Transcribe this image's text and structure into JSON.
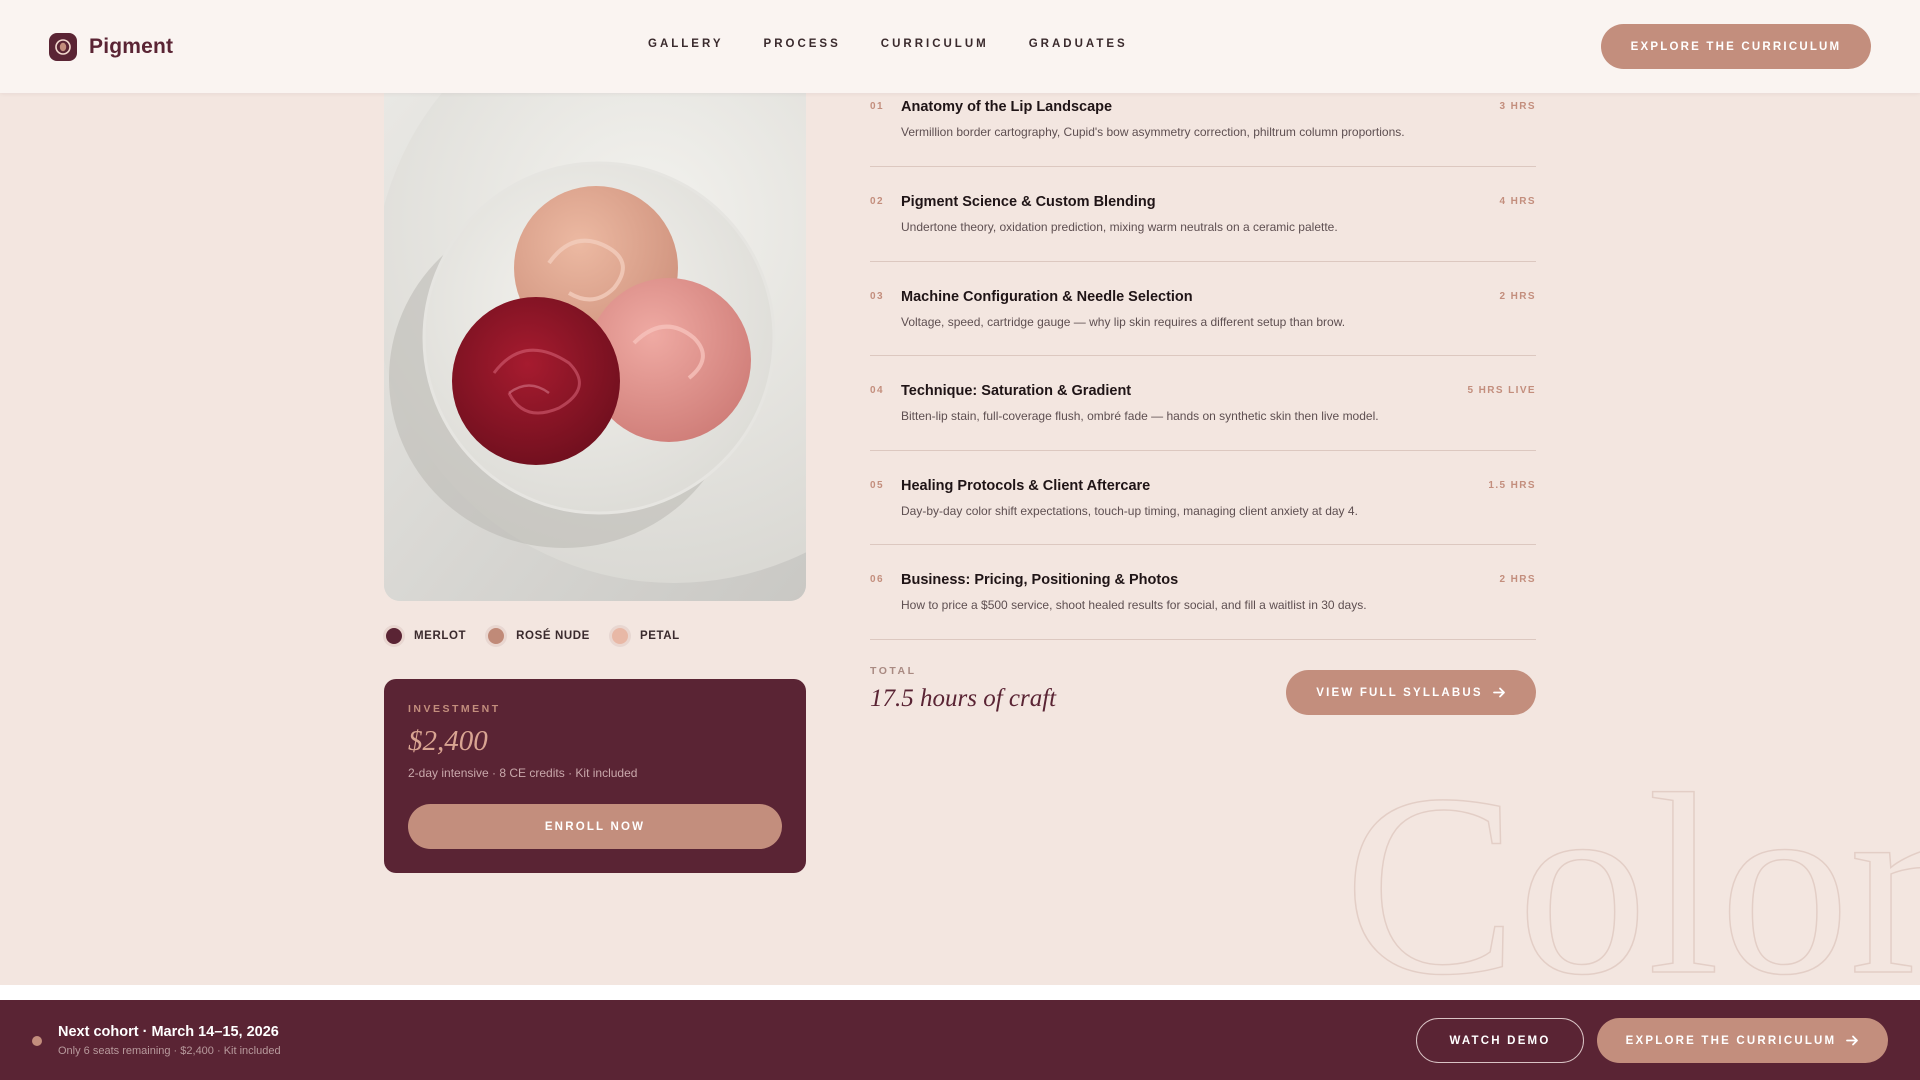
{
  "brand": {
    "name": "Pigment",
    "icon": "lip-logo-icon"
  },
  "nav": [
    {
      "label": "GALLERY"
    },
    {
      "label": "PROCESS"
    },
    {
      "label": "CURRICULUM"
    },
    {
      "label": "GRADUATES"
    }
  ],
  "header": {
    "cta_label": "EXPLORE THE CURRICULUM"
  },
  "swatches": [
    {
      "label": "MERLOT",
      "color": "#5a2434"
    },
    {
      "label": "ROSÉ NUDE",
      "color": "#c08a78"
    },
    {
      "label": "PETAL",
      "color": "#e8b8a6"
    }
  ],
  "investment": {
    "label": "INVESTMENT",
    "price": "$2,400",
    "meta": "2-day intensive · 8 CE credits · Kit included",
    "enroll_label": "ENROLL NOW"
  },
  "modules": [
    {
      "num": "01",
      "title": "Anatomy of the Lip Landscape",
      "desc": "Vermillion border cartography, Cupid's bow asymmetry correction, philtrum column proportions.",
      "hours": "3 HRS"
    },
    {
      "num": "02",
      "title": "Pigment Science & Custom Blending",
      "desc": "Undertone theory, oxidation prediction, mixing warm neutrals on a ceramic palette.",
      "hours": "4 HRS"
    },
    {
      "num": "03",
      "title": "Machine Configuration & Needle Selection",
      "desc": "Voltage, speed, cartridge gauge — why lip skin requires a different setup than brow.",
      "hours": "2 HRS"
    },
    {
      "num": "04",
      "title": "Technique: Saturation & Gradient",
      "desc": "Bitten-lip stain, full-coverage flush, ombré fade — hands on synthetic skin then live model.",
      "hours": "5 HRS LIVE"
    },
    {
      "num": "05",
      "title": "Healing Protocols & Client Aftercare",
      "desc": "Day-by-day color shift expectations, touch-up timing, managing client anxiety at day 4.",
      "hours": "1.5 HRS"
    },
    {
      "num": "06",
      "title": "Business: Pricing, Positioning & Photos",
      "desc": "How to price a $500 service, shoot healed results for social, and fill a waitlist in 30 days.",
      "hours": "2 HRS"
    }
  ],
  "total": {
    "label": "TOTAL",
    "value": "17.5 hours of craft"
  },
  "syllabus_button": {
    "label": "VIEW FULL SYLLABUS",
    "icon": "arrow-right-icon"
  },
  "watermark": {
    "text": "Color"
  },
  "bottom_bar": {
    "cohort_title": "Next cohort · March 14–15, 2026",
    "cohort_sub": "Only 6 seats remaining · $2,400 · Kit included",
    "watch_label": "WATCH DEMO",
    "cta_label": "EXPLORE THE CURRICULUM",
    "cta_icon": "arrow-right-icon"
  },
  "colors": {
    "background": "#f3e6e0",
    "header": "#faf4f1",
    "accent": "#c38e7d",
    "plum": "#5a2434"
  }
}
